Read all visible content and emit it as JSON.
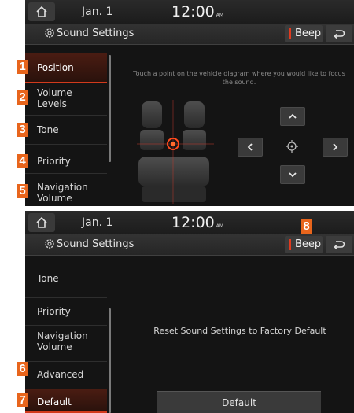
{
  "status": {
    "date": "Jan. 1",
    "time": "12:00",
    "ampm": "AM"
  },
  "header": {
    "title": "Sound Settings",
    "beep_label": "Beep"
  },
  "screen1": {
    "menu": [
      {
        "label": "Position",
        "badge": "1"
      },
      {
        "label": "Volume\nLevels",
        "badge": "2"
      },
      {
        "label": "Tone",
        "badge": "3"
      },
      {
        "label": "Priority",
        "badge": "4"
      },
      {
        "label": "Navigation\nVolume",
        "badge": "5"
      }
    ],
    "instruction": "Touch a point on the vehicle diagram where you would like to focus the sound."
  },
  "screen2": {
    "menu": [
      {
        "label": "Tone"
      },
      {
        "label": "Priority"
      },
      {
        "label": "Navigation\nVolume"
      },
      {
        "label": "Advanced",
        "badge": "6"
      },
      {
        "label": "Default",
        "badge": "7"
      }
    ],
    "beep_badge": "8",
    "reset_message": "Reset Sound Settings to Factory Default",
    "default_button": "Default"
  },
  "colors": {
    "accent": "#d23a1c",
    "badge": "#e8651c",
    "background": "#141414"
  },
  "icons": [
    "home-icon",
    "gear-icon",
    "back-icon",
    "chevron-up-icon",
    "chevron-down-icon",
    "chevron-left-icon",
    "chevron-right-icon",
    "focus-target-icon"
  ]
}
